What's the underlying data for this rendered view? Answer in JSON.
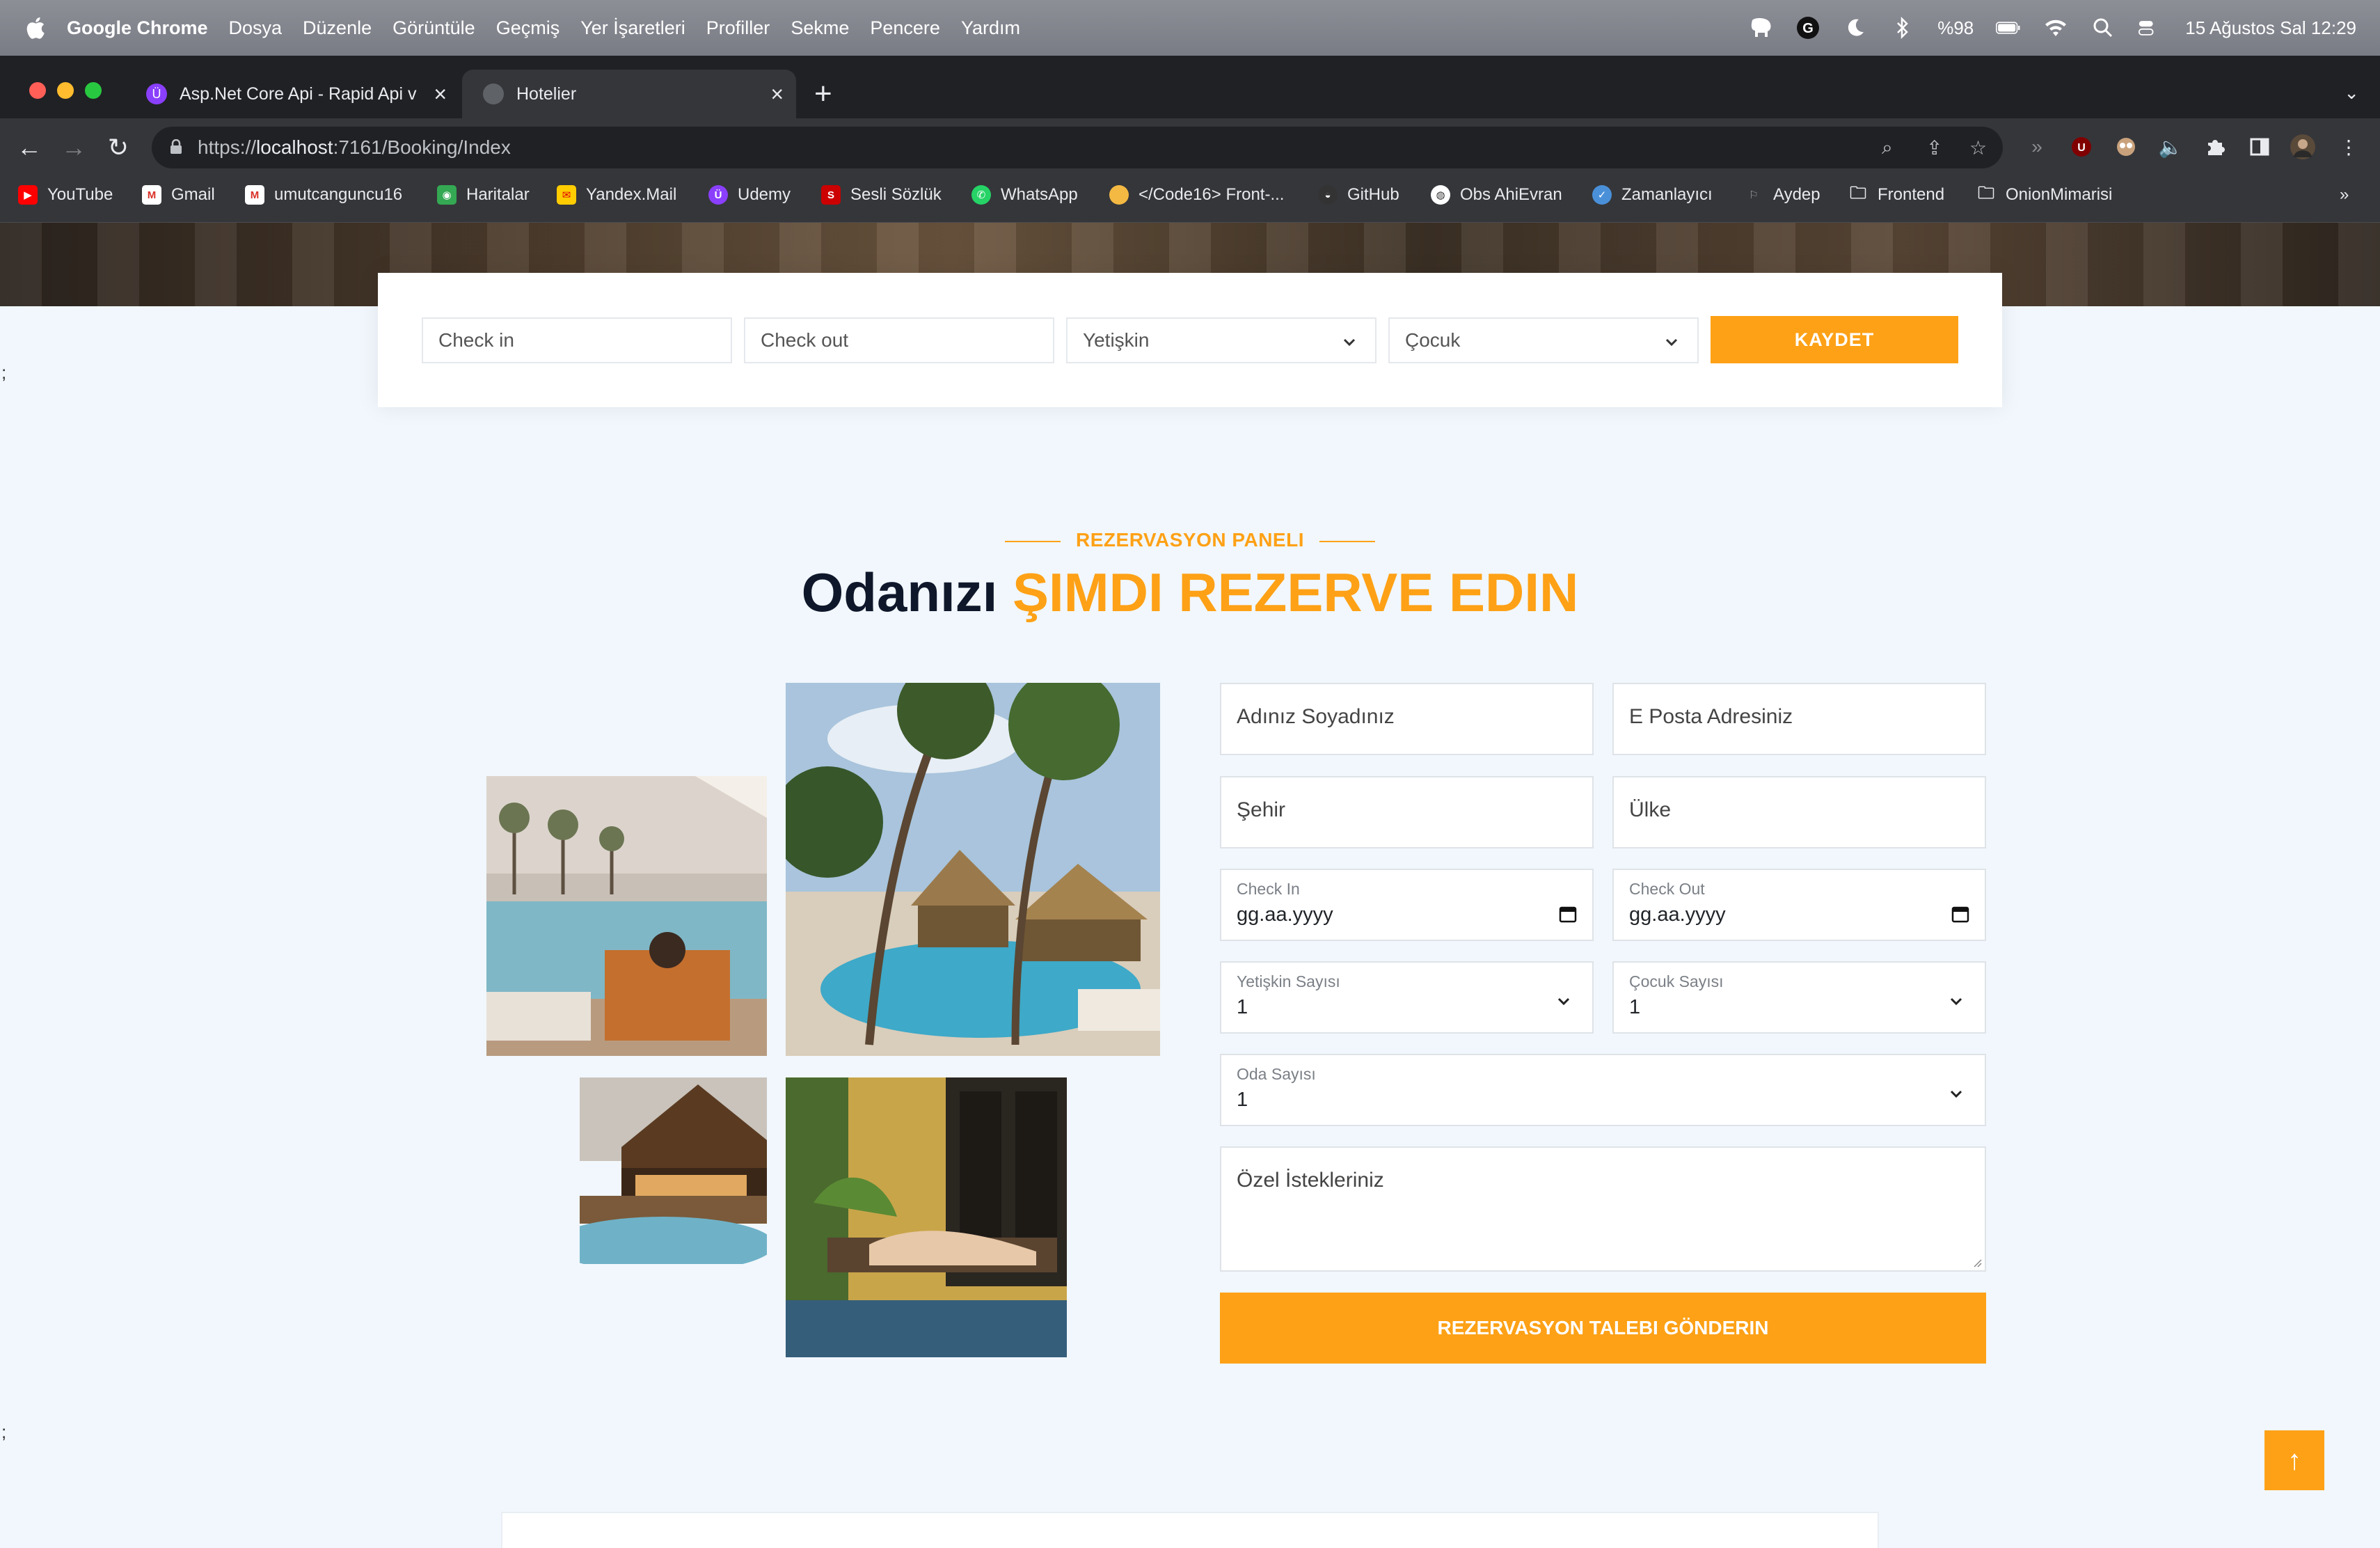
{
  "menubar": {
    "app_name": "Google Chrome",
    "menus": [
      "Dosya",
      "Düzenle",
      "Görüntüle",
      "Geçmiş",
      "Yer İşaretleri",
      "Profiller",
      "Sekme",
      "Pencere",
      "Yardım"
    ],
    "battery": "%98",
    "datetime": "15 Ağustos Sal  12:29"
  },
  "tabs": [
    {
      "title": "Asp.Net Core Api - Rapid Api v",
      "active": false
    },
    {
      "title": "Hotelier",
      "active": true
    }
  ],
  "omnibox": {
    "scheme": "https://",
    "host": "localhost",
    "path": ":7161/Booking/Index"
  },
  "bookmarks": [
    "YouTube",
    "Gmail",
    "umutcanguncu16",
    "Haritalar",
    "Yandex.Mail",
    "Udemy",
    "Sesli Sözlük",
    "WhatsApp",
    "</Code16> Front-...",
    "GitHub",
    "Obs AhiEvran",
    "Zamanlayıcı",
    "Aydep",
    "Frontend",
    "OnionMimarisi"
  ],
  "search_bar": {
    "checkin_placeholder": "Check in",
    "checkout_placeholder": "Check out",
    "adult_select": "Yetişkin",
    "child_select": "Çocuk",
    "button": "KAYDET"
  },
  "section": {
    "eyebrow": "REZERVASYON PANELI",
    "title_dark": "Odanızı",
    "title_accent": "ŞIMDI REZERVE EDIN"
  },
  "form": {
    "name_placeholder": "Adınız Soyadınız",
    "email_placeholder": "E Posta Adresiniz",
    "city_placeholder": "Şehir",
    "country_placeholder": "Ülke",
    "checkin_label": "Check In",
    "checkin_value": "gg.aa.yyyy",
    "checkout_label": "Check Out",
    "checkout_value": "gg.aa.yyyy",
    "adults_label": "Yetişkin Sayısı",
    "adults_value": "1",
    "children_label": "Çocuk Sayısı",
    "children_value": "1",
    "rooms_label": "Oda Sayısı",
    "rooms_value": "1",
    "requests_placeholder": "Özel İstekleriniz",
    "submit": "REZERVASYON TALEBI GÖNDERIN"
  },
  "stray_text": ";",
  "colors": {
    "accent": "#FEA116",
    "dark": "#0F172B",
    "page_bg": "#F1F7FC"
  }
}
